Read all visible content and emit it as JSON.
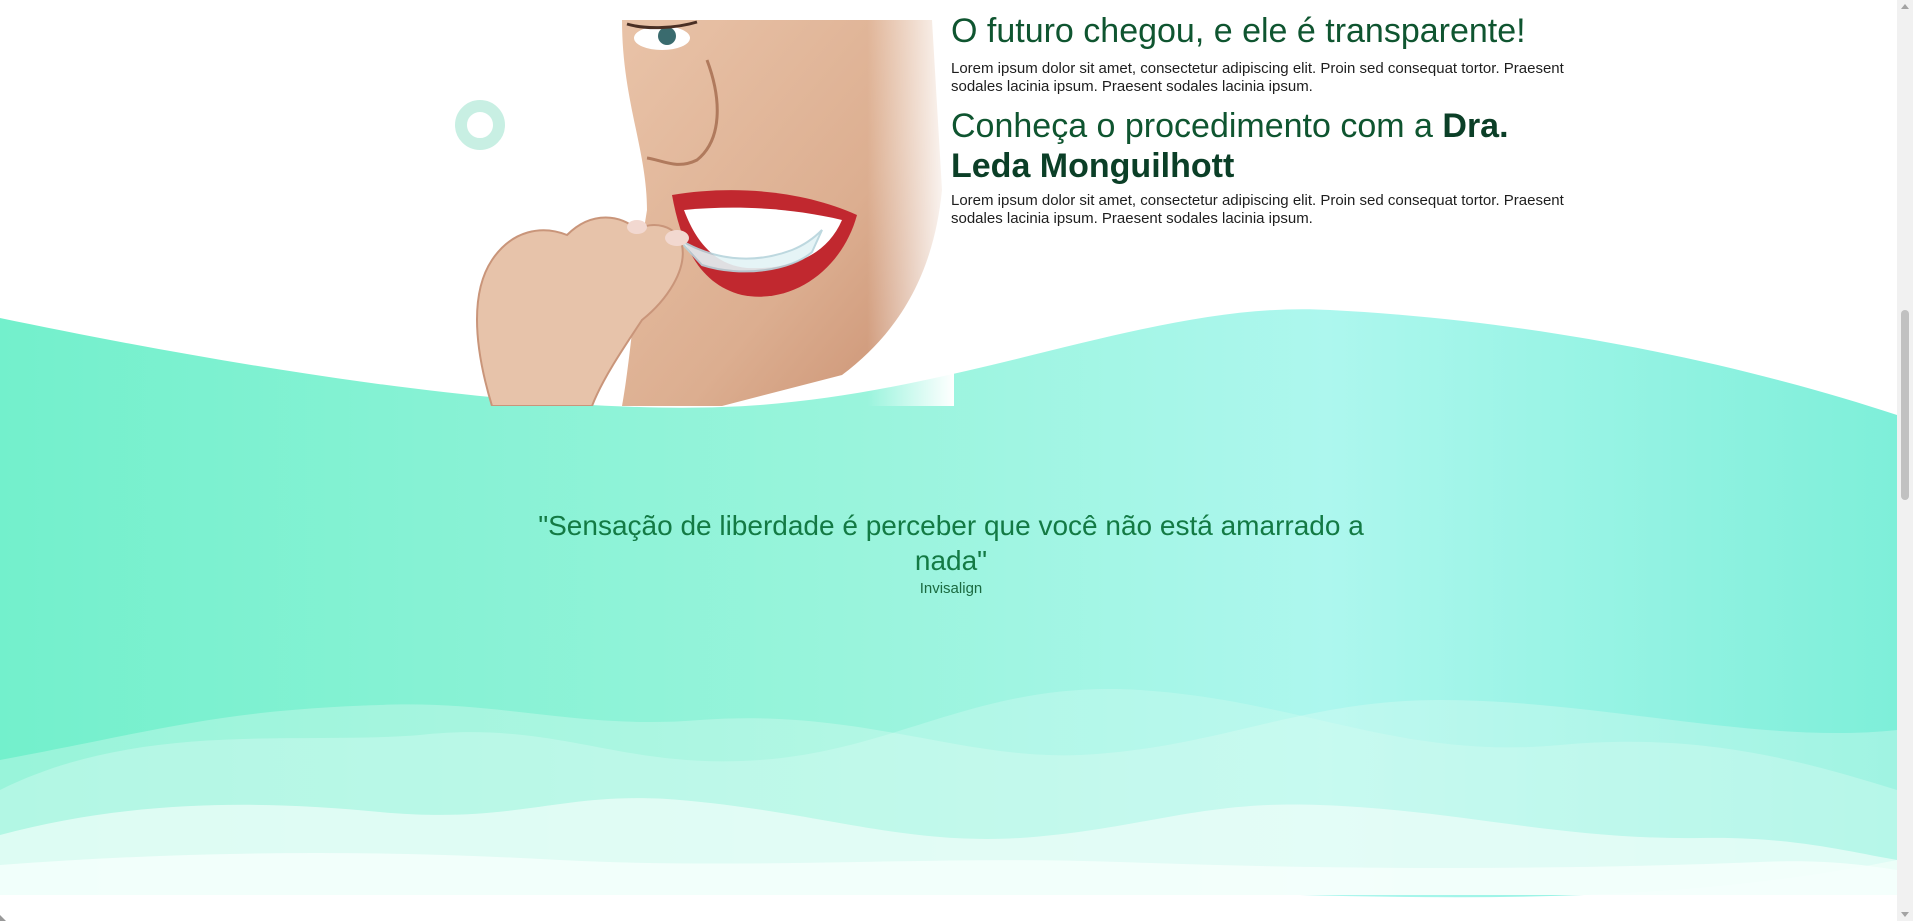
{
  "hero": {
    "title": "O futuro chegou, e ele é transparente!",
    "paragraph1": "Lorem ipsum dolor sit amet, consectetur adipiscing elit. Proin sed consequat tortor. Praesent sodales lacinia ipsum. Praesent sodales lacinia ipsum.",
    "subtitle_prefix": "Conheça o procedimento com a ",
    "subtitle_name": "Dra. Leda Monguilhott",
    "paragraph2": "Lorem ipsum dolor sit amet, consectetur adipiscing elit. Proin sed consequat tortor. Praesent sodales lacinia ipsum. Praesent sodales lacinia ipsum.",
    "image_icon": "woman-holding-aligner-photo"
  },
  "testimonial": {
    "quote": "\"Sensação de liberdade é perceber que você não está amarrado a nada\"",
    "author": "Invisalign"
  },
  "colors": {
    "brand_dark_green": "#0f5530",
    "quote_green": "#137a44",
    "mint": "#7ef0d2",
    "aqua": "#a8f6ee",
    "ring": "#c8efe3"
  }
}
